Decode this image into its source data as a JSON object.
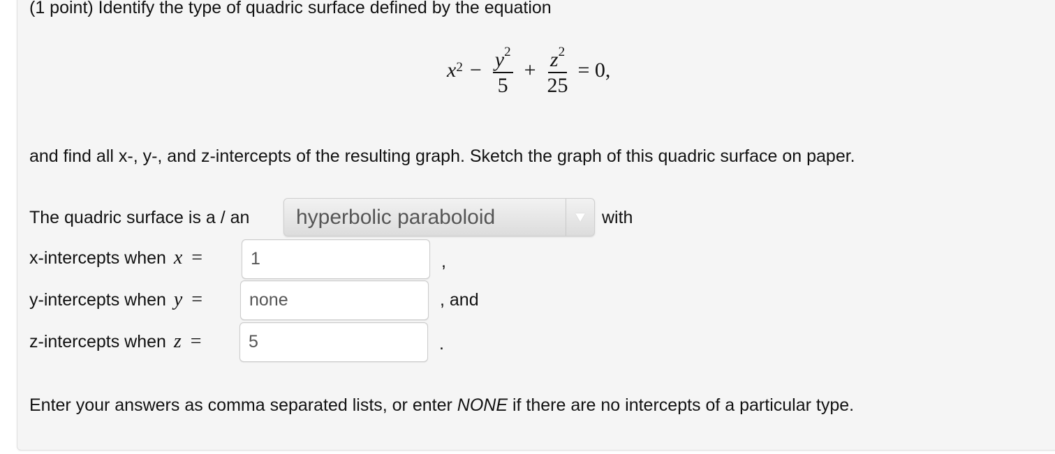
{
  "problem": {
    "intro": "(1 point) Identify the type of quadric surface defined by the equation",
    "equation": {
      "x_term": "x",
      "x_exp": "2",
      "op1": "−",
      "y_num": "y",
      "y_exp": "2",
      "y_den": "5",
      "op2": "+",
      "z_num": "z",
      "z_exp": "2",
      "z_den": "25",
      "rhs": "= 0,"
    },
    "instructions": "and find all x-, y-, and z-intercepts of the resulting graph. Sketch the graph of this quadric surface on paper.",
    "surface_prefix": "The quadric surface is a / an",
    "surface_select": {
      "selected": "hyperbolic paraboloid",
      "icon": "chevron-down-icon"
    },
    "surface_suffix": "with",
    "x_row": {
      "label": "x-intercepts when",
      "var": "x",
      "eq": "=",
      "value": "1",
      "trailing": ","
    },
    "y_row": {
      "label": "y-intercepts when",
      "var": "y",
      "eq": "=",
      "value": "none",
      "trailing": ", and"
    },
    "z_row": {
      "label": "z-intercepts when",
      "var": "z",
      "eq": "=",
      "value": "5",
      "trailing": "."
    },
    "footer": {
      "before": "Enter your answers as comma separated lists, or enter ",
      "emphasis": "NONE",
      "after": " if there are no intercepts of a particular type."
    }
  }
}
